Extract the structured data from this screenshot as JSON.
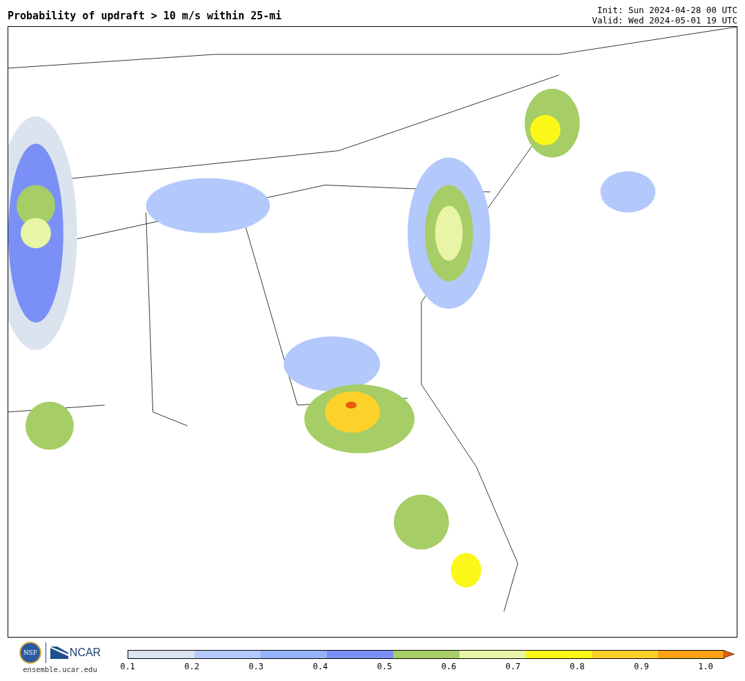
{
  "title": "Probability of updraft > 10 m/s within 25-mi",
  "init": "Init: Sun 2024-04-28 00 UTC",
  "valid": "Valid: Wed 2024-05-01 19 UTC",
  "logos": {
    "nsf": "NSF",
    "ncar": "NCAR",
    "site": "ensemble.ucar.edu"
  },
  "colorbar": {
    "segments": [
      {
        "color": "#dbe4ee"
      },
      {
        "color": "#b3c8fb"
      },
      {
        "color": "#93b4fa"
      },
      {
        "color": "#7a90f6"
      },
      {
        "color": "#a6cd66"
      },
      {
        "color": "#e8f5a6"
      },
      {
        "color": "#fbf719"
      },
      {
        "color": "#fcd12a"
      },
      {
        "color": "#fba113"
      }
    ],
    "extend": {
      "color": "#e85b0c"
    },
    "ticks": [
      "0.1",
      "0.2",
      "0.3",
      "0.4",
      "0.5",
      "0.6",
      "0.7",
      "0.8",
      "0.9",
      "1.0"
    ]
  }
}
